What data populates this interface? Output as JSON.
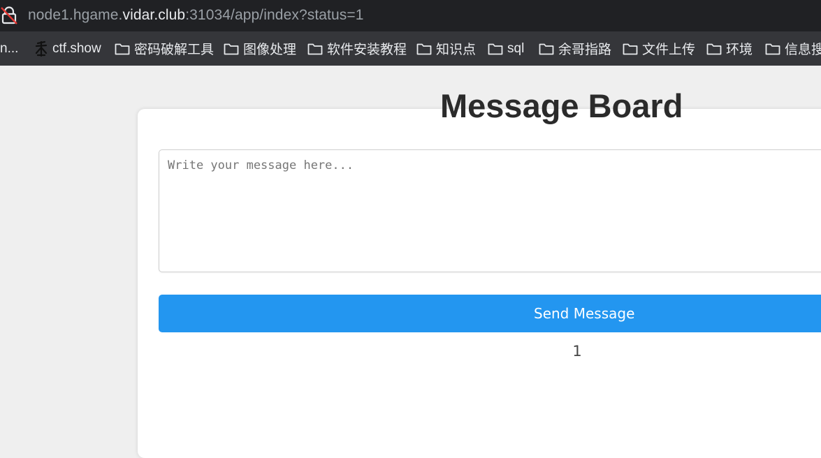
{
  "browser": {
    "url_prefix": "node1.hgame.",
    "url_host": "vidar.club",
    "url_suffix": ":31034/app/index?status=1"
  },
  "bookmarks": {
    "truncated_label": "n...",
    "items": [
      {
        "label": "ctf.show",
        "icon": "ctfshow-icon"
      },
      {
        "label": "密码破解工具",
        "icon": "folder-icon"
      },
      {
        "label": "图像处理",
        "icon": "folder-icon"
      },
      {
        "label": "软件安装教程",
        "icon": "folder-icon"
      },
      {
        "label": "知识点",
        "icon": "folder-icon"
      },
      {
        "label": "sql",
        "icon": "folder-icon"
      },
      {
        "label": "余哥指路",
        "icon": "folder-icon"
      },
      {
        "label": "文件上传",
        "icon": "folder-icon"
      },
      {
        "label": "环境",
        "icon": "folder-icon"
      },
      {
        "label": "信息搜",
        "icon": "folder-icon"
      }
    ]
  },
  "board": {
    "title": "Message Board",
    "placeholder": "Write your message here...",
    "send_label": "Send Message",
    "status_value": "1"
  },
  "colors": {
    "accent": "#2396f0",
    "page_bg": "#efefef",
    "toolbar_bg": "#202124",
    "bookmarks_bg": "#35363a"
  }
}
